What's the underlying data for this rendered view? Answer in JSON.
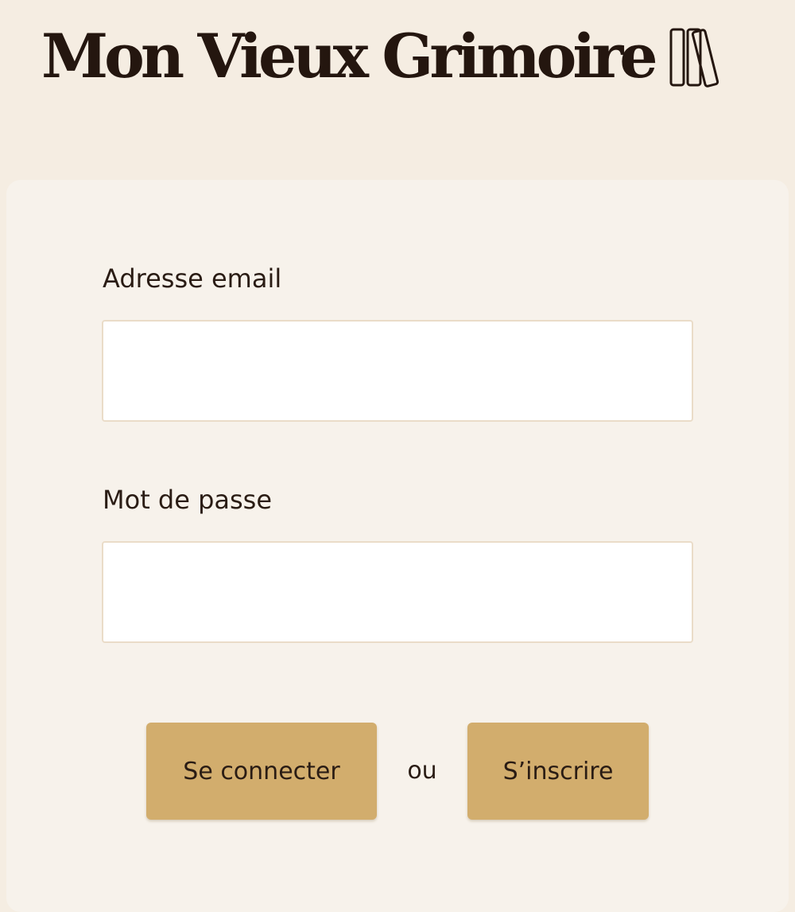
{
  "header": {
    "title": "Mon Vieux Grimoire",
    "logo_icon": "books-icon"
  },
  "form": {
    "email_label": "Adresse email",
    "email_value": "",
    "password_label": "Mot de passe",
    "password_value": "",
    "login_button": "Se connecter",
    "separator": "ou",
    "signup_button": "S’inscrire"
  },
  "colors": {
    "background": "#f5ede2",
    "card": "#f7f2eb",
    "button": "#d2ad6d",
    "text": "#2a1c14"
  }
}
